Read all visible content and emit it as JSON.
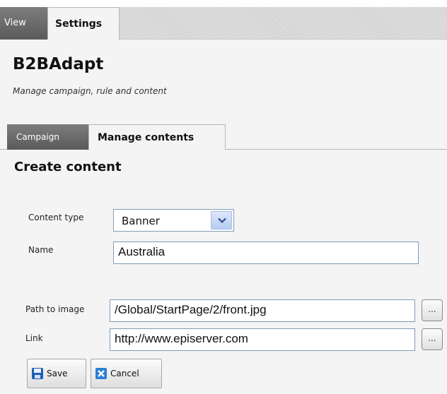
{
  "top_tabs": [
    {
      "label": "View"
    },
    {
      "label": "Settings"
    }
  ],
  "header": {
    "title": "B2BAdapt",
    "subtitle": "Manage campaign, rule and content"
  },
  "sub_tabs": [
    {
      "label": "Campaign"
    },
    {
      "label": "Manage contents"
    }
  ],
  "form": {
    "section_title": "Create content",
    "content_type": {
      "label": "Content type",
      "value": "Banner"
    },
    "name": {
      "label": "Name",
      "value": "Australia"
    },
    "path": {
      "label": "Path to image",
      "value": "/Global/StartPage/2/front.jpg"
    },
    "link": {
      "label": "Link",
      "value": "http://www.episerver.com"
    },
    "browse_label": "...",
    "save_label": "Save",
    "cancel_label": "Cancel"
  },
  "icons": {
    "save": "floppy-disk-icon",
    "cancel": "close-x-icon",
    "dropdown": "chevron-down-icon"
  },
  "colors": {
    "save_icon": "#1e5fb4",
    "cancel_icon": "#2a7fd4",
    "dropdown_button": "#b6cbf3",
    "input_border": "#7f9db9"
  }
}
